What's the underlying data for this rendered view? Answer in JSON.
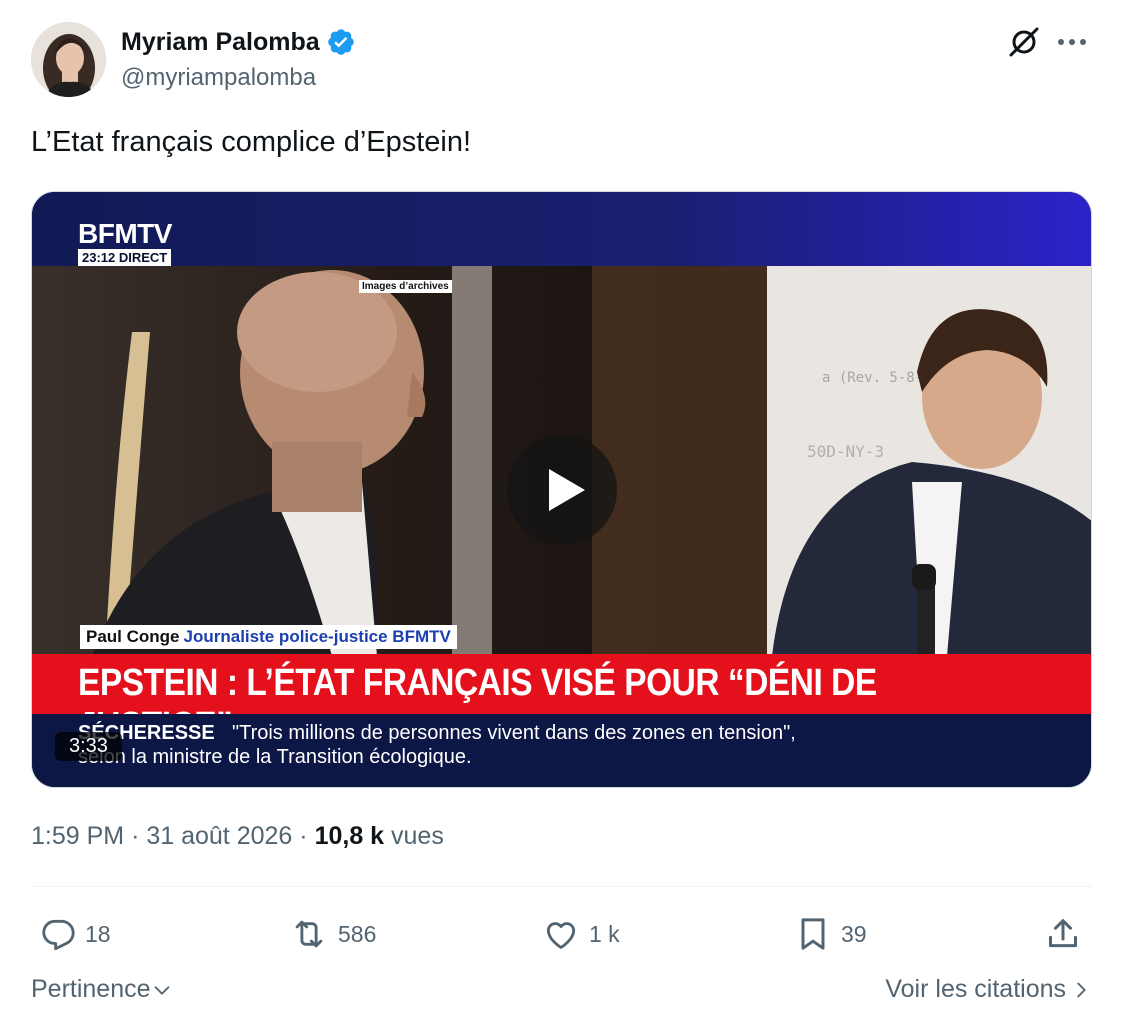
{
  "author": {
    "display_name": "Myriam Palomba",
    "handle": "@myriampalomba",
    "verified": true
  },
  "icons": {
    "verified": "verified-badge-icon",
    "grok": "grok-icon",
    "more": "more-dots-icon",
    "reply": "reply-icon",
    "repost": "repost-icon",
    "like": "like-heart-icon",
    "bookmark": "bookmark-icon",
    "share": "share-icon",
    "chevron_down": "chevron-down-icon",
    "chevron_right": "chevron-right-icon",
    "play": "play-icon"
  },
  "tweet": {
    "text": "L’Etat français complice d’Epstein!",
    "time": "1:59 PM",
    "date": "31 août 2026",
    "separator": "·",
    "views_count": "10,8 k",
    "views_label": "vues"
  },
  "video": {
    "duration": "3:33",
    "channel": "BFMTV",
    "channel_time": "23:12  DIRECT",
    "archive_tag": "Images d’archives",
    "guest_name": "Paul Conge",
    "guest_role": "Journaliste police-justice BFMTV",
    "headline": "EPSTEIN : L’ÉTAT FRANÇAIS VISÉ POUR “DÉNI DE JUSTICE”",
    "ticker_label": "SÉCHERESSE",
    "ticker_line1": "\"Trois millions de personnes vivent dans des zones en tension\",",
    "ticker_line2": "selon la ministre de la Transition écologique."
  },
  "actions": {
    "replies": "18",
    "reposts": "586",
    "likes": "1 k",
    "bookmarks": "39"
  },
  "footer": {
    "sort_label": "Pertinence",
    "quotes_label": "Voir les citations"
  },
  "colors": {
    "text": "#0f1419",
    "secondary": "#536471",
    "verified": "#1d9bf0",
    "banner_red": "#e4101b",
    "ticker_navy": "#0d1746"
  }
}
